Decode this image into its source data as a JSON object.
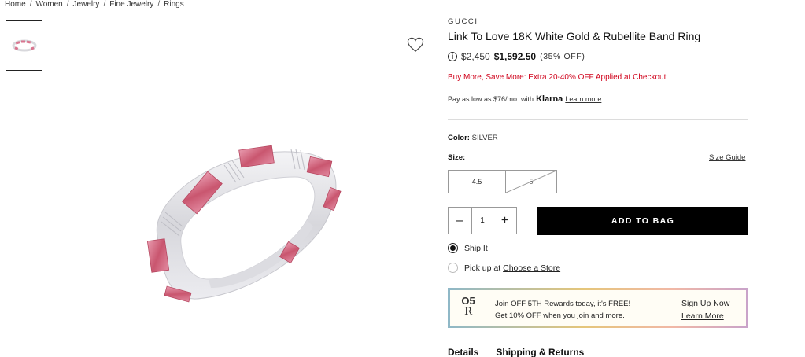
{
  "breadcrumb": {
    "items": [
      "Home",
      "Women",
      "Jewelry",
      "Fine Jewelry",
      "Rings"
    ],
    "separator": "/"
  },
  "product": {
    "brand": "GUCCI",
    "title": "Link To Love 18K White Gold & Rubellite Band Ring",
    "original_price": "$2,450",
    "sale_price": "$1,592.50",
    "discount": "(35% OFF)",
    "promo": "Buy More, Save More: Extra 20-40% OFF Applied at Checkout",
    "klarna": {
      "prefix": "Pay as low as $76/mo. with",
      "logo": "Klarna",
      "link": "Learn more"
    },
    "color_label": "Color:",
    "color_value": "SILVER",
    "size_label": "Size:",
    "size_guide": "Size Guide",
    "sizes": [
      {
        "label": "4.5",
        "available": true
      },
      {
        "label": "5",
        "available": false
      }
    ]
  },
  "purchase": {
    "minus": "–",
    "quantity": "1",
    "plus": "+",
    "add_to_bag": "ADD TO BAG"
  },
  "fulfillment": {
    "ship_it": "Ship It",
    "pickup_prefix": "Pick up at",
    "pickup_link": "Choose a Store",
    "selected": "ship"
  },
  "rewards": {
    "logo_top": "O5",
    "logo_bottom": "R",
    "headline": "Join OFF 5TH Rewards today, it's FREE!",
    "subline": "Get 10% OFF when you join and more.",
    "signup": "Sign Up Now",
    "learn": "Learn More"
  },
  "tabs": [
    "Details",
    "Shipping & Returns"
  ],
  "icons": {
    "info": "info-circle-icon",
    "wishlist": "heart-outline-icon"
  },
  "colors": {
    "promo_red": "#d0021b",
    "button_black": "#000000",
    "rubellite": "#d9758f"
  }
}
